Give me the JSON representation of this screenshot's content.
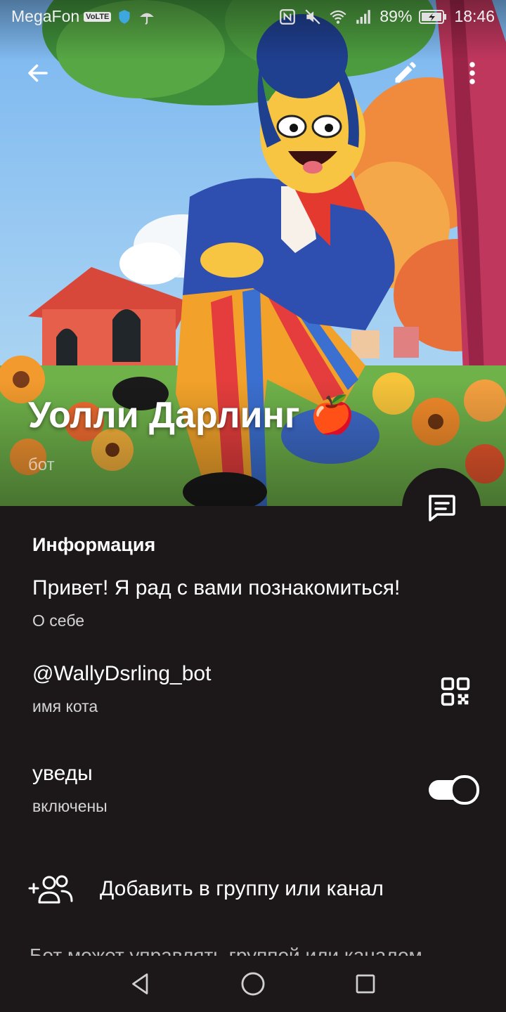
{
  "status_bar": {
    "carrier": "MegaFon",
    "volte": "VoLTE",
    "battery": "89%",
    "time": "18:46"
  },
  "profile": {
    "name": "Уолли Дарлинг",
    "name_emoji": "🍎",
    "subtitle": "бот"
  },
  "info": {
    "section_title": "Информация",
    "bio": "Привет! Я рад с вами познакомиться!",
    "bio_caption": "О себе",
    "username": "@WallyDsrling_bot",
    "username_caption": "имя кота",
    "notifications": "уведы",
    "notifications_caption": "включены",
    "notifications_enabled": true
  },
  "actions": {
    "add_to_group": "Добавить в группу или канал",
    "hint": "Бот может управлять группой или каналом"
  },
  "colors": {
    "background": "#1c1819",
    "text": "#ffffff",
    "secondary_text": "#d4d4d4"
  },
  "icons": {
    "back": "arrow-left-icon",
    "edit": "pencil-icon",
    "more": "kebab-menu-icon",
    "message": "chat-bubble-icon",
    "qr": "qr-code-icon",
    "add_member": "add-users-icon",
    "nav_back": "triangle-back-icon",
    "nav_home": "circle-home-icon",
    "nav_recents": "square-recents-icon"
  }
}
